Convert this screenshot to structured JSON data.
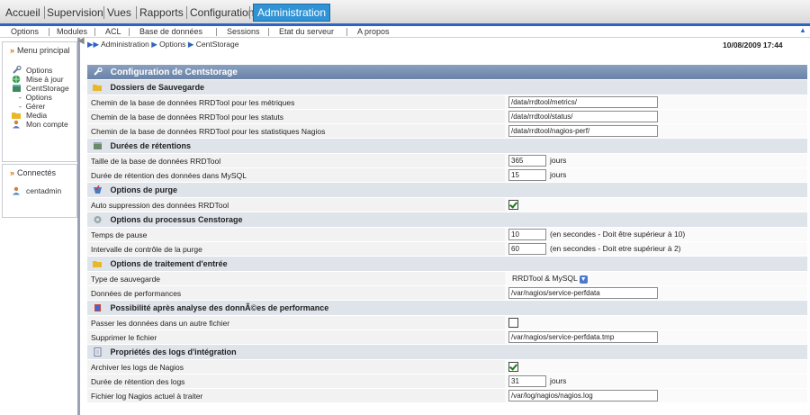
{
  "topnav": {
    "tabs": [
      "Accueil",
      "Supervision",
      "Vues",
      "Rapports",
      "Configuration",
      "Administration"
    ],
    "active": "Administration"
  },
  "subnav": [
    "Options",
    "Modules",
    "ACL",
    "Base de données",
    "Sessions",
    "Etat du serveur",
    "A propos"
  ],
  "sidebar": {
    "menu_title": "Menu principal",
    "items": [
      "Options",
      "Mise à jour",
      "CentStorage"
    ],
    "sub_items": [
      "Options",
      "Gérer"
    ],
    "items2": [
      "Media",
      "Mon compte"
    ],
    "connected_title": "Connectés",
    "connected_user": "centadmin"
  },
  "breadcrumb": {
    "part1": "Administration",
    "part2": "Options",
    "part3": "CentStorage"
  },
  "datetime": "10/08/2009 17:44",
  "config": {
    "title": "Configuration de Centstorage",
    "sections": [
      {
        "title": "Dossiers de Sauvegarde",
        "icon": "folder-icon"
      },
      {
        "title": "Durées de rétentions",
        "icon": "database-icon"
      },
      {
        "title": "Options de purge",
        "icon": "purge-icon"
      },
      {
        "title": "Options du processus Censtorage",
        "icon": "gear-icon"
      },
      {
        "title": "Options de traitement d'entrée",
        "icon": "folder-icon"
      },
      {
        "title": "Possibilité après analyse des donnÃ©es de performance",
        "icon": "book-icon"
      },
      {
        "title": "Propriétés des logs d'intégration",
        "icon": "document-icon"
      }
    ],
    "rows": {
      "metrics_label": "Chemin de la base de données RRDTool pour les métriques",
      "metrics_value": "/data/rrdtool/metrics/",
      "status_label": "Chemin de la base de données RRDTool pour les statuts",
      "status_value": "/data/rrdtool/status/",
      "nagios_label": "Chemin de la base de données RRDTool pour les statistiques Nagios",
      "nagios_value": "/data/rrdtool/nagios-perf/",
      "rrd_size_label": "Taille de la base de données RRDTool",
      "rrd_size_value": "365",
      "rrd_size_unit": "jours",
      "mysql_ret_label": "Durée de rétention des données dans MySQL",
      "mysql_ret_value": "15",
      "mysql_ret_unit": "jours",
      "auto_purge_label": "Auto suppression des données RRDTool",
      "pause_label": "Temps de pause",
      "pause_value": "10",
      "pause_hint": "(en secondes - Doit être supérieur à 10)",
      "purge_int_label": "Intervalle de contrôle de la purge",
      "purge_int_value": "60",
      "purge_int_hint": "(en secondes - Doit etre supérieur à 2)",
      "backup_type_label": "Type de sauvegarde",
      "backup_type_value": "RRDTool & MySQL",
      "perfdata_label": "Données de performances",
      "perfdata_value": "/var/nagios/service-perfdata",
      "move_label": "Passer les données dans un autre fichier",
      "delete_label": "Supprimer le fichier",
      "delete_value": "/var/nagios/service-perfdata.tmp",
      "archive_label": "Archiver les logs de Nagios",
      "log_ret_label": "Durée de rétention des logs",
      "log_ret_value": "31",
      "log_ret_unit": "jours",
      "log_file_label": "Fichier log Nagios actuel à traiter",
      "log_file_value": "/var/log/nagios/nagios.log"
    },
    "checkboxes": {
      "auto_purge": true,
      "move": false,
      "archive": true
    }
  }
}
